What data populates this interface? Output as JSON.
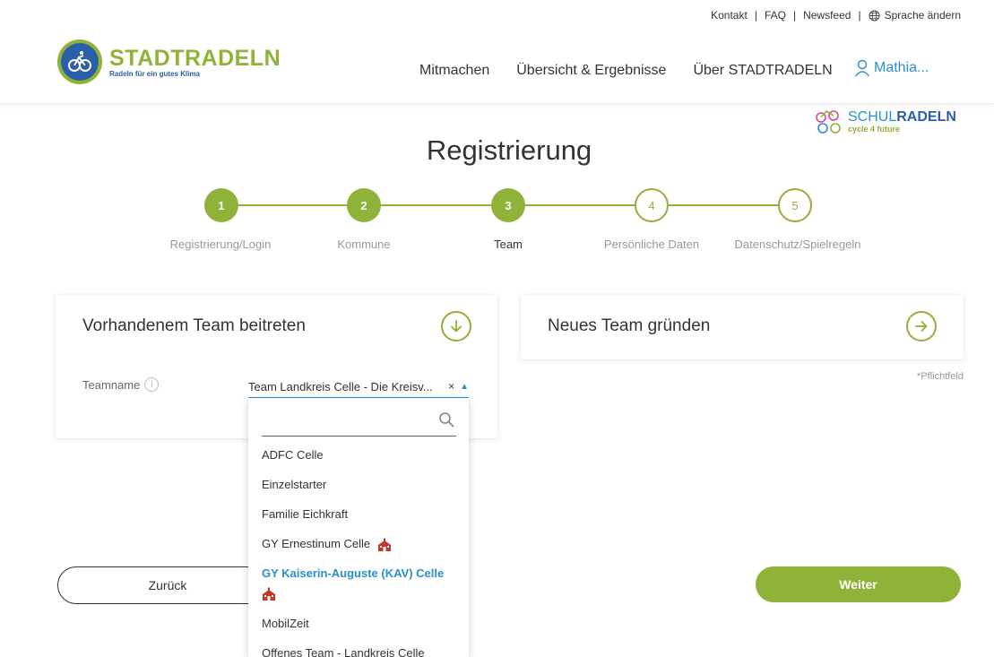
{
  "utility": {
    "contact": "Kontakt",
    "faq": "FAQ",
    "newsfeed": "Newsfeed",
    "language": "Sprache ändern"
  },
  "logo": {
    "title": "STADTRADELN",
    "subtitle": "Radeln für ein gutes Klima"
  },
  "nav": {
    "items": [
      "Mitmachen",
      "Übersicht & Ergebnisse",
      "Über STADTRADELN"
    ],
    "user": "Mathia..."
  },
  "schulradeln": {
    "title_a": "SCHUL",
    "title_b": "RADELN",
    "subtitle": "cycle 4 future"
  },
  "page_title": "Registrierung",
  "stepper": {
    "steps": [
      {
        "number": "1",
        "label": "Registrierung/Login",
        "state": "done"
      },
      {
        "number": "2",
        "label": "Kommune",
        "state": "done"
      },
      {
        "number": "3",
        "label": "Team",
        "state": "active"
      },
      {
        "number": "4",
        "label": "Persönliche Daten",
        "state": "todo"
      },
      {
        "number": "5",
        "label": "Datenschutz/Spielregeln",
        "state": "todo"
      }
    ]
  },
  "join_card": {
    "title": "Vorhandenem Team beitreten",
    "field_label": "Teamname",
    "selected_value": "Team Landkreis Celle - Die Kreisv...",
    "clear": "×",
    "arrow": "▲"
  },
  "new_card": {
    "title": "Neues Team gründen"
  },
  "required_note": "*Pflichtfeld",
  "buttons": {
    "back": "Zurück",
    "next": "Weiter"
  },
  "dropdown": {
    "search_value": "",
    "options": [
      {
        "label": "ADFC Celle",
        "school": false,
        "highlight": false
      },
      {
        "label": "Einzelstarter",
        "school": false,
        "highlight": false
      },
      {
        "label": "Familie Eichkraft",
        "school": false,
        "highlight": false
      },
      {
        "label": "GY Ernestinum Celle",
        "school": true,
        "highlight": false
      },
      {
        "label": "GY Kaiserin-Auguste (KAV) Celle",
        "school": true,
        "highlight": true
      },
      {
        "label": "MobilZeit",
        "school": false,
        "highlight": false
      },
      {
        "label": "Offenes Team - Landkreis Celle",
        "school": false,
        "highlight": false
      }
    ]
  },
  "colors": {
    "green": "#8fb238",
    "blue": "#2a5ea8",
    "link_blue": "#2a8fd0"
  }
}
